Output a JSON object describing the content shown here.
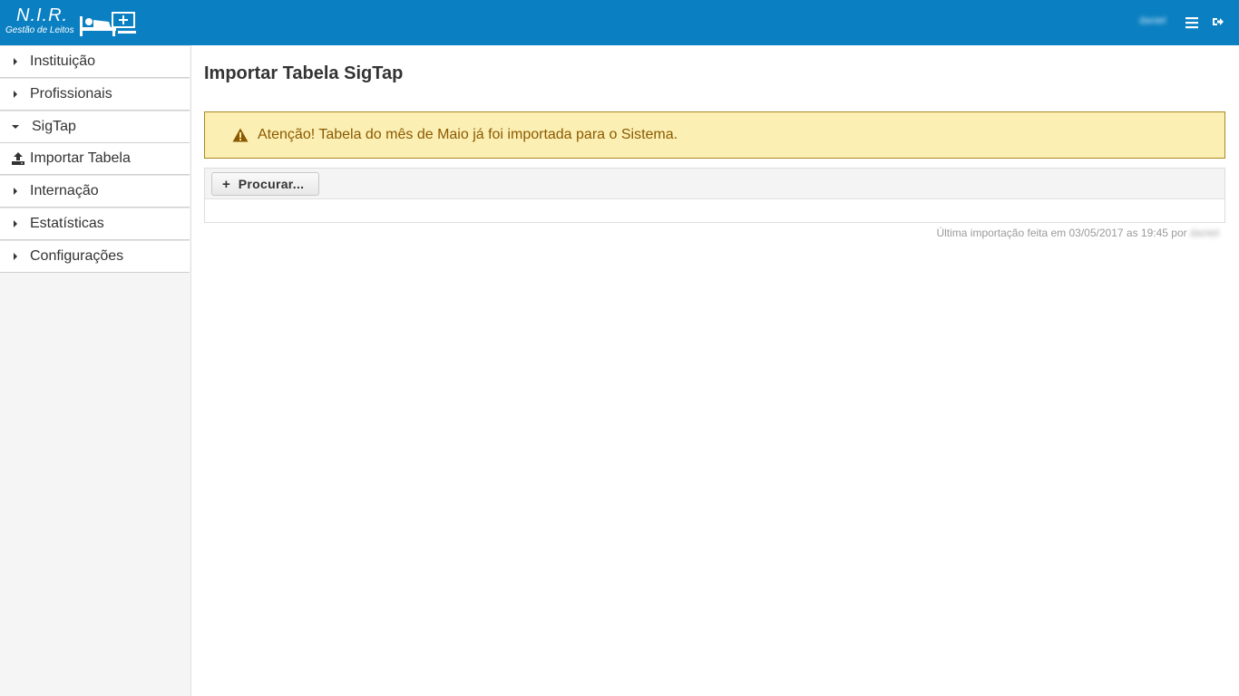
{
  "header": {
    "logo_title": "N.I.R.",
    "logo_subtitle": "Gestão de Leitos",
    "user_name": "daniel",
    "brand_color": "#0a7fc2",
    "icons": [
      "menu-icon",
      "logout-icon"
    ]
  },
  "sidebar": {
    "items": [
      {
        "label": "Instituição",
        "expanded": false
      },
      {
        "label": "Profissionais",
        "expanded": false
      },
      {
        "label": "SigTap",
        "expanded": true
      },
      {
        "label": "Importar Tabela",
        "sub": true,
        "icon": "upload-icon"
      },
      {
        "label": "Internação",
        "expanded": false
      },
      {
        "label": "Estatísticas",
        "expanded": false
      },
      {
        "label": "Configurações",
        "expanded": false
      }
    ]
  },
  "main": {
    "title": "Importar Tabela SigTap",
    "alert": {
      "text": "Atenção! Tabela do mês de Maio já foi importada para o Sistema.",
      "icon": "warning-icon",
      "background": "#fcefb4",
      "color": "#8a5a00"
    },
    "upload": {
      "browse_label": "Procurar..."
    },
    "last_import": {
      "text": "Última importação feita em 03/05/2017 as 19:45 por",
      "user": "daniel"
    }
  }
}
